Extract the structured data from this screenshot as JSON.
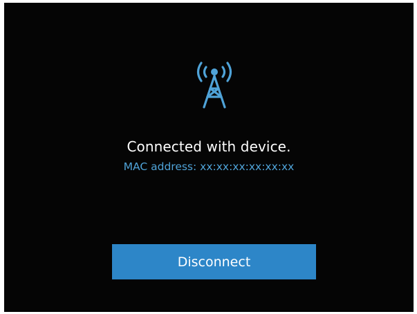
{
  "connection": {
    "icon": "wireless-tower-icon",
    "status_text": "Connected with device.",
    "mac_label": "MAC address: xx:xx:xx:xx:xx:xx"
  },
  "actions": {
    "disconnect_label": "Disconnect"
  },
  "colors": {
    "background": "#050505",
    "accent": "#4fa3d8",
    "button": "#2d86c8",
    "text": "#ffffff"
  }
}
